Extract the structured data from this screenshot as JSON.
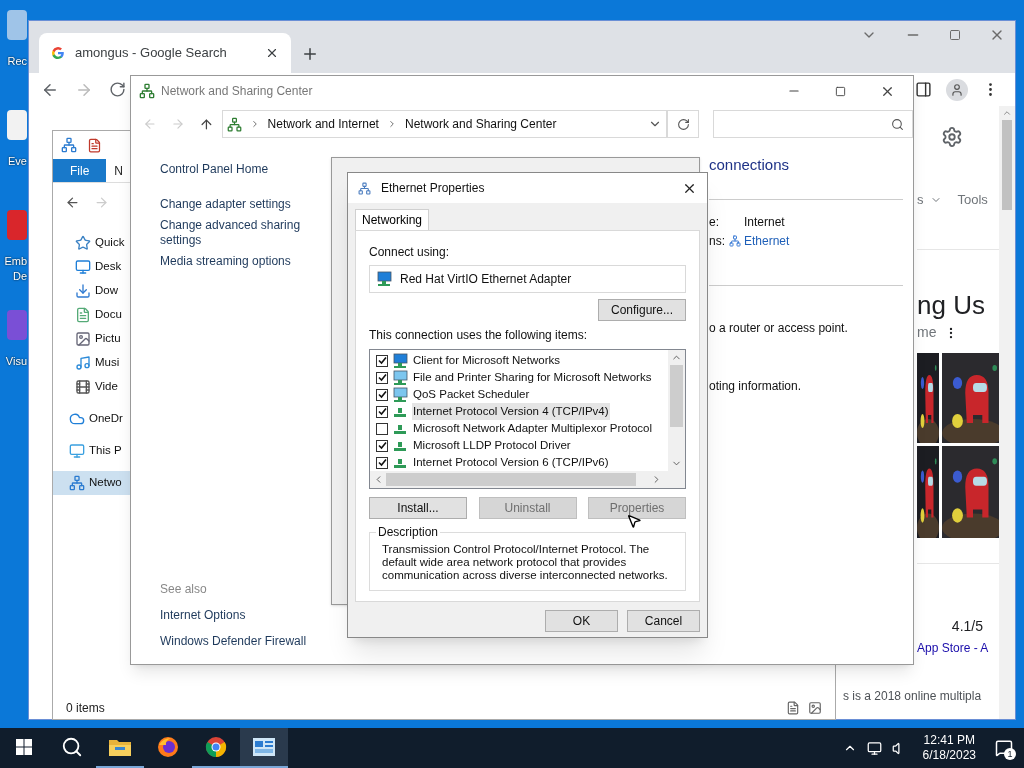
{
  "desktop_icons": [
    {
      "lines": [
        "Rec"
      ]
    },
    {
      "lines": [
        "Eve"
      ]
    },
    {
      "lines": [
        "Emb",
        "De"
      ]
    },
    {
      "lines": [
        "Visu"
      ]
    }
  ],
  "browser": {
    "tab_title": "amongus - Google Search",
    "page": {
      "filter_tail": "s",
      "tools": "Tools",
      "heading": "ng Us",
      "subheading": "me",
      "rating": "4.1/5",
      "source_link": "App Store - A",
      "snippet": "s is a 2018 online multipla"
    }
  },
  "explorer": {
    "ribbon_tabs": [
      {
        "label": "File",
        "selected": true
      },
      {
        "label": "N",
        "selected": false
      }
    ],
    "nav_items": [
      {
        "label": "Quick",
        "kind": "star",
        "selected": false
      },
      {
        "label": "Desk",
        "kind": "desktop",
        "selected": false
      },
      {
        "label": "Dow",
        "kind": "download",
        "selected": false
      },
      {
        "label": "Docu",
        "kind": "document",
        "selected": false
      },
      {
        "label": "Pictu",
        "kind": "pictures",
        "selected": false
      },
      {
        "label": "Musi",
        "kind": "music",
        "selected": false
      },
      {
        "label": "Vide",
        "kind": "video",
        "selected": false
      },
      {
        "label": "OneDr",
        "kind": "cloud",
        "selected": false
      },
      {
        "label": "This P",
        "kind": "computer",
        "selected": false
      },
      {
        "label": "Netwo",
        "kind": "network",
        "selected": true
      }
    ],
    "status": "0 items"
  },
  "sharing_center": {
    "title": "Network and Sharing Center",
    "breadcrumb": [
      "Network and Internet",
      "Network and Sharing Center"
    ],
    "links": [
      "Control Panel Home",
      "Change adapter settings",
      "Change advanced sharing settings",
      "Media streaming options"
    ],
    "see_also_heading": "See also",
    "see_also": [
      "Internet Options",
      "Windows Defender Firewall"
    ],
    "header_tail": "connections",
    "info": [
      {
        "label": "e:",
        "value": "Internet",
        "link": false
      },
      {
        "label": "ns:",
        "value": "Ethernet",
        "link": true
      }
    ],
    "notes": [
      "o a router or access point.",
      "oting information."
    ]
  },
  "properties": {
    "title": "Ethernet Properties",
    "tabs": [
      {
        "label": "Networking",
        "selected": true
      }
    ],
    "connect_label": "Connect using:",
    "adapter": "Red Hat VirtIO Ethernet Adapter",
    "configure": "Configure...",
    "items_label": "This connection uses the following items:",
    "items": [
      {
        "label": "Client for Microsoft Networks",
        "kind": "client",
        "checked": true,
        "selected": false
      },
      {
        "label": "File and Printer Sharing for Microsoft Networks",
        "kind": "service",
        "checked": true,
        "selected": false
      },
      {
        "label": "QoS Packet Scheduler",
        "kind": "service",
        "checked": true,
        "selected": false
      },
      {
        "label": "Internet Protocol Version 4 (TCP/IPv4)",
        "kind": "protocol",
        "checked": true,
        "selected": true
      },
      {
        "label": "Microsoft Network Adapter Multiplexor Protocol",
        "kind": "protocol",
        "checked": false,
        "selected": false
      },
      {
        "label": "Microsoft LLDP Protocol Driver",
        "kind": "protocol",
        "checked": true,
        "selected": false
      },
      {
        "label": "Internet Protocol Version 6 (TCP/IPv6)",
        "kind": "protocol",
        "checked": true,
        "selected": false
      }
    ],
    "buttons": [
      {
        "label": "Install...",
        "disabled": false
      },
      {
        "label": "Uninstall",
        "disabled": true
      },
      {
        "label": "Properties",
        "disabled": true
      }
    ],
    "description_label": "Description",
    "description": "Transmission Control Protocol/Internet Protocol. The default wide area network protocol that provides communication across diverse interconnected networks.",
    "ok": "OK",
    "cancel": "Cancel"
  },
  "taskbar": {
    "apps": [
      {
        "kind": "start",
        "running": false,
        "active": false
      },
      {
        "kind": "search",
        "running": false,
        "active": false
      },
      {
        "kind": "explorer",
        "running": true,
        "active": false
      },
      {
        "kind": "firefox",
        "running": false,
        "active": false
      },
      {
        "kind": "chrome",
        "running": true,
        "active": false
      },
      {
        "kind": "control-panel",
        "running": true,
        "active": true
      }
    ],
    "time": "12:41 PM",
    "date": "6/18/2023",
    "notifications": "1"
  }
}
